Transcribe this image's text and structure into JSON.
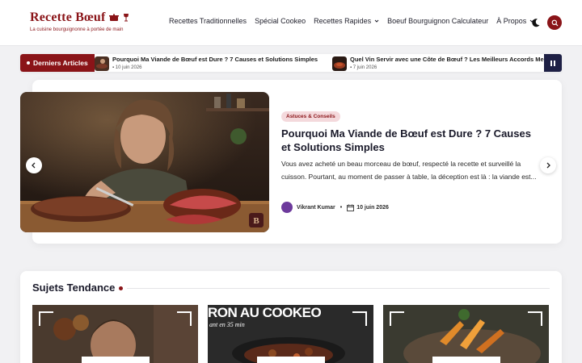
{
  "site": {
    "title": "Recette Bœuf",
    "tagline": "La cuisine bourguignonne à portée de main"
  },
  "nav": {
    "items": [
      {
        "label": "Recettes Traditionnelles",
        "dropdown": false
      },
      {
        "label": "Spécial Cookeo",
        "dropdown": false
      },
      {
        "label": "Recettes Rapides",
        "dropdown": true
      },
      {
        "label": "Boeuf Bourguignon Calculateur",
        "dropdown": false
      },
      {
        "label": "À Propos",
        "dropdown": true
      }
    ]
  },
  "ticker": {
    "label": "Derniers Articles",
    "items": [
      {
        "title": "Pourquoi Ma Viande de Bœuf est Dure ? 7 Causes et Solutions Simples",
        "date": "10 juin 2026"
      },
      {
        "title": "Quel Vin Servir avec une Côte de Bœuf ? Les Meilleurs Accords Me",
        "date": "7 juin 2026"
      }
    ]
  },
  "hero": {
    "category": "Astuces & Conseils",
    "title": "Pourquoi Ma Viande de Bœuf est Dure ? 7 Causes et Solutions Simples",
    "excerpt": "Vous avez acheté un beau morceau de bœuf, respecté la recette et surveillé la cuisson. Pourtant, au moment de passer à table, la déception est là : la viande est...",
    "author": "Vikrant Kumar",
    "date": "10 juin 2026"
  },
  "trending": {
    "title": "Sujets Tendance",
    "cards": [
      {
        "overlay_line1": "",
        "overlay_line2": ""
      },
      {
        "overlay_line1": "RON AU COOKEO",
        "overlay_line2": "ant en 35 min"
      },
      {
        "overlay_line1": "",
        "overlay_line2": ""
      }
    ]
  },
  "colors": {
    "brand": "#8a1418",
    "ticker_pause": "#1e2045",
    "badge_bg": "#f4d9dc"
  },
  "icons": [
    "cooking-pot-icon",
    "wine-glass-icon",
    "chevron-down-icon",
    "moon-icon",
    "search-icon",
    "pause-icon",
    "chevron-left-icon",
    "chevron-right-icon",
    "calendar-icon"
  ]
}
